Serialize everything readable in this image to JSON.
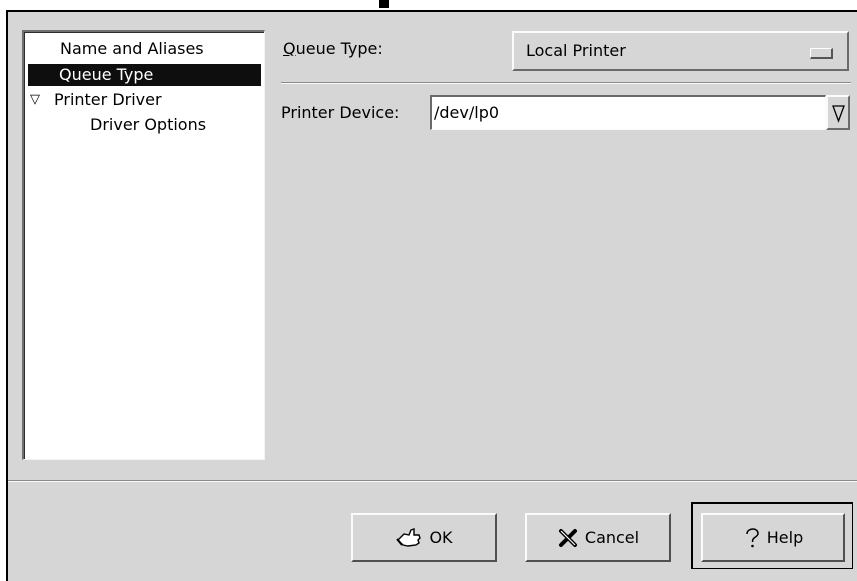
{
  "tree": {
    "items": [
      {
        "label": "Name and Aliases",
        "selected": false
      },
      {
        "label": "Queue Type",
        "selected": true
      },
      {
        "label": "Printer Driver",
        "expander": "▽"
      },
      {
        "label": "Driver Options"
      }
    ]
  },
  "queue_type": {
    "label_mnemonic": "Q",
    "label_rest": "ueue Type:",
    "value": "Local Printer"
  },
  "printer_device": {
    "label": "Printer Device:",
    "value": "/dev/lp0"
  },
  "buttons": {
    "ok": "OK",
    "cancel": "Cancel",
    "help": "Help"
  },
  "icons": {
    "ok": "ok-hand-icon",
    "cancel": "cancel-x-icon",
    "help": "question-mark-icon",
    "combo": "down-triangle-icon",
    "option_menu": "option-menu-indicator-icon"
  }
}
